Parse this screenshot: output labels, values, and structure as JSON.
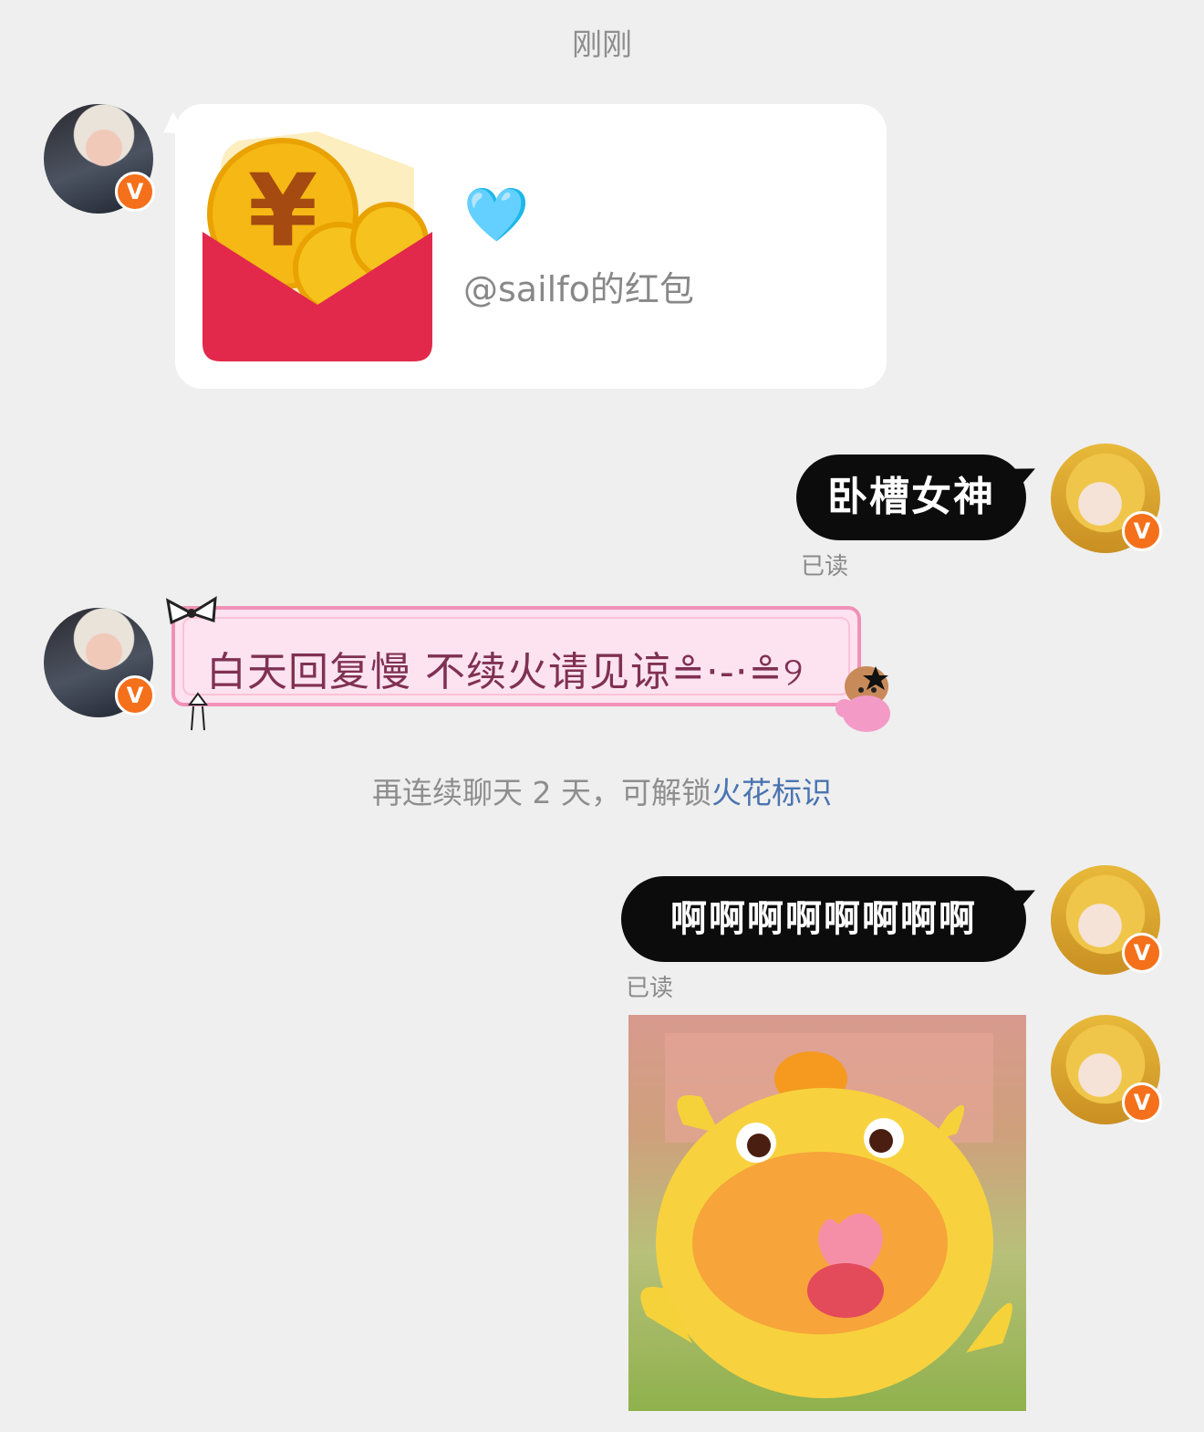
{
  "timestamp": "刚刚",
  "messages": {
    "red_packet": {
      "heart": "🩵",
      "label": "@sailfo的红包",
      "yuan_symbol": "¥"
    },
    "msg1": {
      "text": "卧槽女神",
      "status": "已读"
    },
    "msg2": {
      "text": "白天回复慢  不续火请见谅≗·-·≗୨"
    },
    "system_notice": {
      "prefix": "再连续聊天 2 天，可解锁",
      "link": "火花标识"
    },
    "msg3": {
      "text": "啊啊啊啊啊啊啊啊",
      "status": "已读"
    }
  },
  "badge": "V",
  "colors": {
    "background": "#efefef",
    "bubble_black": "#0c0c0c",
    "pink_bubble": "#fde3ef",
    "pink_border": "#f191b8",
    "verified_badge": "#f5701a",
    "link": "#4a74b0",
    "red_packet": "#e2294b",
    "coin": "#f5b814"
  }
}
